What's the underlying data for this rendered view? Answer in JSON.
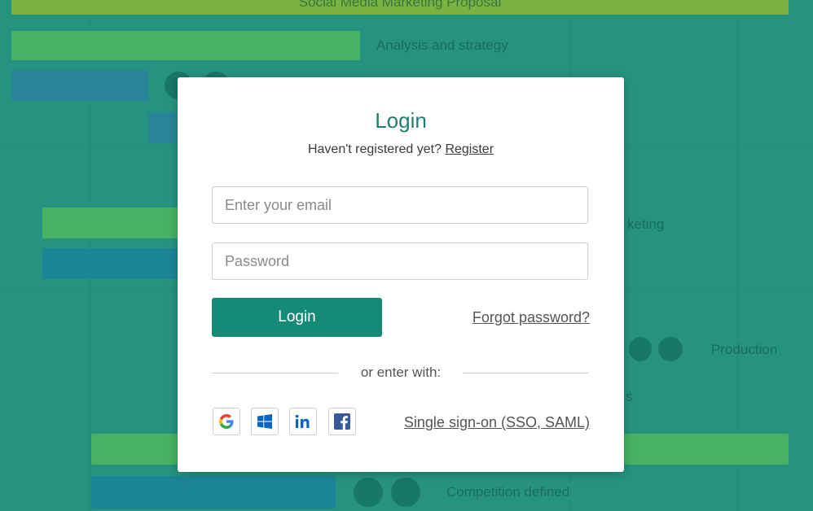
{
  "background": {
    "header_title": "Social Media Marketing Proposal",
    "labels": [
      "Analysis and strategy",
      "keting",
      "Production",
      "s",
      "Competition defined"
    ]
  },
  "modal": {
    "title": "Login",
    "subtitle_text": "Haven't registered yet?",
    "register_link": "Register",
    "email_placeholder": "Enter your email",
    "password_placeholder": "Password",
    "login_button": "Login",
    "forgot_link": "Forgot password?",
    "divider_text": "or enter with:",
    "social_providers": [
      {
        "name": "Google",
        "icon": "google-icon"
      },
      {
        "name": "Windows",
        "icon": "windows-icon"
      },
      {
        "name": "LinkedIn",
        "icon": "linkedin-icon"
      },
      {
        "name": "Facebook",
        "icon": "facebook-icon"
      }
    ],
    "sso_link": "Single sign-on (SSO, SAML)"
  },
  "colors": {
    "accent": "#158a77",
    "title": "#1c7f70",
    "background": "#2a9a86",
    "linkedin": "#0a66c2",
    "facebook": "#3b5998"
  }
}
